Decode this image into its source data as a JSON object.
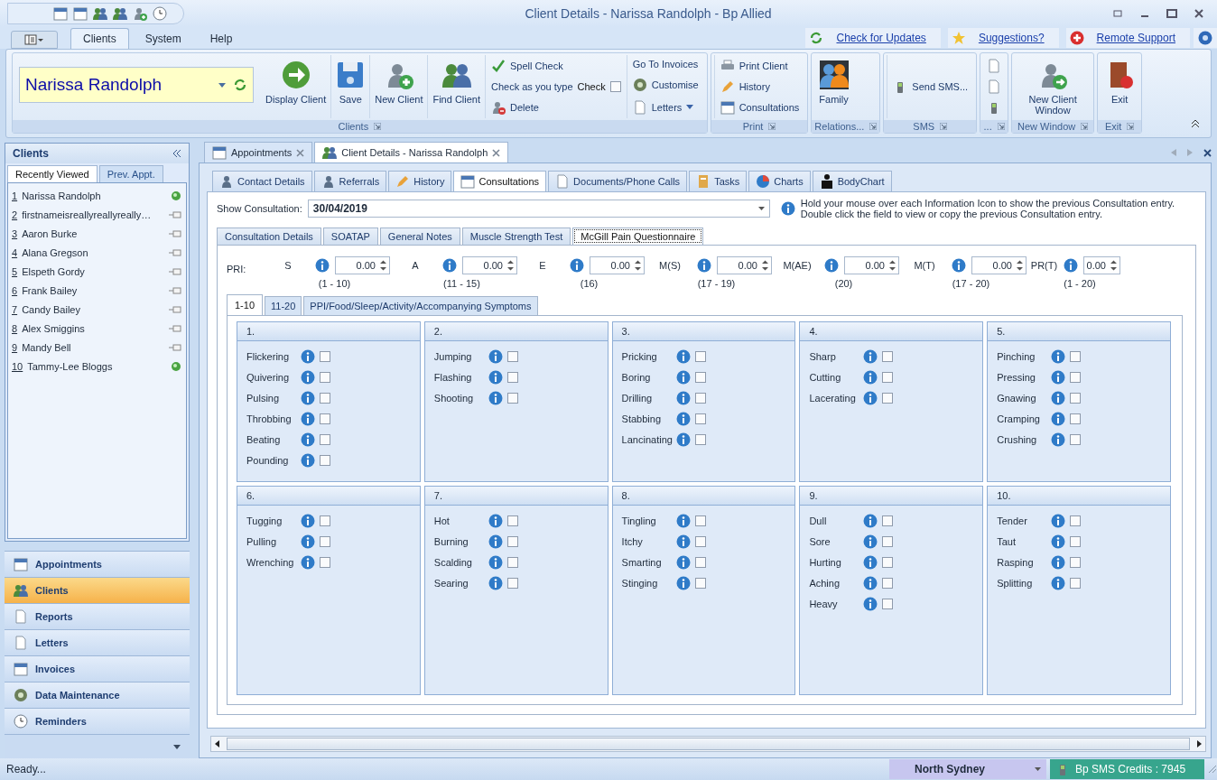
{
  "window": {
    "title": "Client Details - Narissa Randolph - Bp Allied"
  },
  "menu_tabs": [
    {
      "label": "Clients",
      "selected": true
    },
    {
      "label": "System",
      "selected": false
    },
    {
      "label": "Help",
      "selected": false
    }
  ],
  "top_links": [
    {
      "label": "Check for Updates"
    },
    {
      "label": "Suggestions?"
    },
    {
      "label": "Remote Support"
    }
  ],
  "ribbon": {
    "client": "Narissa Randolph",
    "groups": [
      {
        "label": "Clients",
        "buttons": [
          {
            "kind": "large",
            "label": "Display Client"
          },
          {
            "kind": "large",
            "label": "Save"
          },
          {
            "kind": "large",
            "label": "New Client"
          },
          {
            "kind": "large",
            "label": "Find Client"
          },
          {
            "kind": "stack",
            "items": [
              {
                "kind": "button",
                "label": "Spell Check"
              },
              {
                "kind": "check",
                "label": "Check as you type",
                "check_label": "Check",
                "checked": false
              },
              {
                "kind": "button",
                "label": "Delete"
              }
            ]
          },
          {
            "kind": "stack",
            "items": [
              {
                "kind": "button",
                "label": "Go To Invoices"
              },
              {
                "kind": "button",
                "label": "Customise"
              },
              {
                "kind": "menu",
                "label": "Letters"
              }
            ]
          }
        ]
      },
      {
        "label": "Print",
        "buttons": [
          {
            "kind": "stack",
            "items": [
              {
                "kind": "button",
                "label": "Print Client"
              },
              {
                "kind": "button",
                "label": "History"
              },
              {
                "kind": "button",
                "label": "Consultations"
              }
            ]
          }
        ]
      },
      {
        "label": "Relations...",
        "buttons": [
          {
            "kind": "large",
            "label": "Family"
          }
        ]
      },
      {
        "label": "SMS",
        "buttons": [
          {
            "kind": "stack",
            "items": [
              {
                "kind": "button",
                "label": "Send SMS..."
              }
            ]
          }
        ]
      },
      {
        "label": "...",
        "buttons": [
          {
            "kind": "icons"
          }
        ]
      },
      {
        "label": "New Window",
        "buttons": [
          {
            "kind": "large",
            "label": "New Client Window"
          }
        ]
      },
      {
        "label": "Exit",
        "buttons": [
          {
            "kind": "large",
            "label": "Exit"
          }
        ]
      }
    ]
  },
  "sidebar": {
    "title": "Clients",
    "tabs": [
      {
        "label": "Recently Viewed",
        "selected": true
      },
      {
        "label": "Prev. Appt.",
        "selected": false
      }
    ],
    "items": [
      {
        "number": "1",
        "name": "Narissa Randolph",
        "pinned": true
      },
      {
        "number": "2",
        "name": "firstnameisreallyreallyreally…",
        "pinned": false
      },
      {
        "number": "3",
        "name": "Aaron Burke",
        "pinned": false
      },
      {
        "number": "4",
        "name": "Alana Gregson",
        "pinned": false
      },
      {
        "number": "5",
        "name": "Elspeth Gordy",
        "pinned": false
      },
      {
        "number": "6",
        "name": "Frank Bailey",
        "pinned": false
      },
      {
        "number": "7",
        "name": "Candy Bailey",
        "pinned": false
      },
      {
        "number": "8",
        "name": "Alex Smiggins",
        "pinned": false
      },
      {
        "number": "9",
        "name": "Mandy Bell",
        "pinned": false
      },
      {
        "number": "10",
        "name": "Tammy-Lee Bloggs",
        "pinned": true
      }
    ],
    "nav": [
      {
        "label": "Appointments",
        "selected": false
      },
      {
        "label": "Clients",
        "selected": true
      },
      {
        "label": "Reports",
        "selected": false
      },
      {
        "label": "Letters",
        "selected": false
      },
      {
        "label": "Invoices",
        "selected": false
      },
      {
        "label": "Data Maintenance",
        "selected": false
      },
      {
        "label": "Reminders",
        "selected": false
      }
    ]
  },
  "doc_tabs": [
    {
      "label": "Appointments",
      "selected": false
    },
    {
      "label": "Client Details - Narissa Randolph",
      "selected": true
    }
  ],
  "section_tabs": [
    {
      "label": "Contact Details",
      "selected": false
    },
    {
      "label": "Referrals",
      "selected": false
    },
    {
      "label": "History",
      "selected": false
    },
    {
      "label": "Consultations",
      "selected": true
    },
    {
      "label": "Documents/Phone Calls",
      "selected": false
    },
    {
      "label": "Tasks",
      "selected": false
    },
    {
      "label": "Charts",
      "selected": false
    },
    {
      "label": "BodyChart",
      "selected": false
    }
  ],
  "consultation": {
    "label": "Show Consultation:",
    "value": "30/04/2019",
    "note": [
      "Hold your mouse over each Information Icon to show the previous Consultation entry.",
      "Double click the field to view or copy the previous Consultation entry."
    ]
  },
  "sub_tabs": [
    {
      "label": "Consultation Details",
      "selected": false
    },
    {
      "label": "SOATAP",
      "selected": false
    },
    {
      "label": "General Notes",
      "selected": false
    },
    {
      "label": "Muscle Strength Test",
      "selected": false
    },
    {
      "label": "McGill Pain Questionnaire",
      "selected": true
    }
  ],
  "pri": {
    "label": "PRI:",
    "scores": [
      {
        "label": "S",
        "value": "0.00",
        "range": "(1 - 10)"
      },
      {
        "label": "A",
        "value": "0.00",
        "range": "(11 - 15)"
      },
      {
        "label": "E",
        "value": "0.00",
        "range": "(16)"
      },
      {
        "label": "M(S)",
        "value": "0.00",
        "range": "(17 - 19)"
      },
      {
        "label": "M(AE)",
        "value": "0.00",
        "range": "(20)"
      },
      {
        "label": "M(T)",
        "value": "0.00",
        "range": "(17 - 20)"
      },
      {
        "label": "PR(T)",
        "value": "0.00",
        "range": "(1 - 20)"
      }
    ]
  },
  "inner_tabs": [
    {
      "label": "1-10",
      "selected": true
    },
    {
      "label": "11-20",
      "selected": false
    },
    {
      "label": "PPI/Food/Sleep/Activity/Accompanying Symptoms",
      "selected": false
    }
  ],
  "columns": [
    {
      "groups": [
        {
          "title": "1.",
          "items": [
            {
              "label": "Flickering",
              "checked": false
            },
            {
              "label": "Quivering",
              "checked": false
            },
            {
              "label": "Pulsing",
              "checked": false
            },
            {
              "label": "Throbbing",
              "checked": false
            },
            {
              "label": "Beating",
              "checked": false
            },
            {
              "label": "Pounding",
              "checked": false
            }
          ]
        },
        {
          "title": "6.",
          "items": [
            {
              "label": "Tugging",
              "checked": false
            },
            {
              "label": "Pulling",
              "checked": false
            },
            {
              "label": "Wrenching",
              "checked": false
            }
          ]
        }
      ]
    },
    {
      "groups": [
        {
          "title": "2.",
          "items": [
            {
              "label": "Jumping",
              "checked": false
            },
            {
              "label": "Flashing",
              "checked": false
            },
            {
              "label": "Shooting",
              "checked": false
            }
          ]
        },
        {
          "title": "7.",
          "items": [
            {
              "label": "Hot",
              "checked": false
            },
            {
              "label": "Burning",
              "checked": false
            },
            {
              "label": "Scalding",
              "checked": false
            },
            {
              "label": "Searing",
              "checked": false
            }
          ]
        }
      ]
    },
    {
      "groups": [
        {
          "title": "3.",
          "items": [
            {
              "label": "Pricking",
              "checked": false
            },
            {
              "label": "Boring",
              "checked": false
            },
            {
              "label": "Drilling",
              "checked": false
            },
            {
              "label": "Stabbing",
              "checked": false
            },
            {
              "label": "Lancinating",
              "checked": false
            }
          ]
        },
        {
          "title": "8.",
          "items": [
            {
              "label": "Tingling",
              "checked": false
            },
            {
              "label": "Itchy",
              "checked": false
            },
            {
              "label": "Smarting",
              "checked": false
            },
            {
              "label": "Stinging",
              "checked": false
            }
          ]
        }
      ]
    },
    {
      "groups": [
        {
          "title": "4.",
          "items": [
            {
              "label": "Sharp",
              "checked": false
            },
            {
              "label": "Cutting",
              "checked": false
            },
            {
              "label": "Lacerating",
              "checked": false
            }
          ]
        },
        {
          "title": "9.",
          "items": [
            {
              "label": "Dull",
              "checked": false
            },
            {
              "label": "Sore",
              "checked": false
            },
            {
              "label": "Hurting",
              "checked": false
            },
            {
              "label": "Aching",
              "checked": false
            },
            {
              "label": "Heavy",
              "checked": false
            }
          ]
        }
      ]
    },
    {
      "groups": [
        {
          "title": "5.",
          "items": [
            {
              "label": "Pinching",
              "checked": false
            },
            {
              "label": "Pressing",
              "checked": false
            },
            {
              "label": "Gnawing",
              "checked": false
            },
            {
              "label": "Cramping",
              "checked": false
            },
            {
              "label": "Crushing",
              "checked": false
            }
          ]
        },
        {
          "title": "10.",
          "items": [
            {
              "label": "Tender",
              "checked": false
            },
            {
              "label": "Taut",
              "checked": false
            },
            {
              "label": "Rasping",
              "checked": false
            },
            {
              "label": "Splitting",
              "checked": false
            }
          ]
        }
      ]
    }
  ],
  "status_bar": {
    "text": "Ready...",
    "location": "North Sydney",
    "credits": "Bp SMS Credits : 7945"
  }
}
